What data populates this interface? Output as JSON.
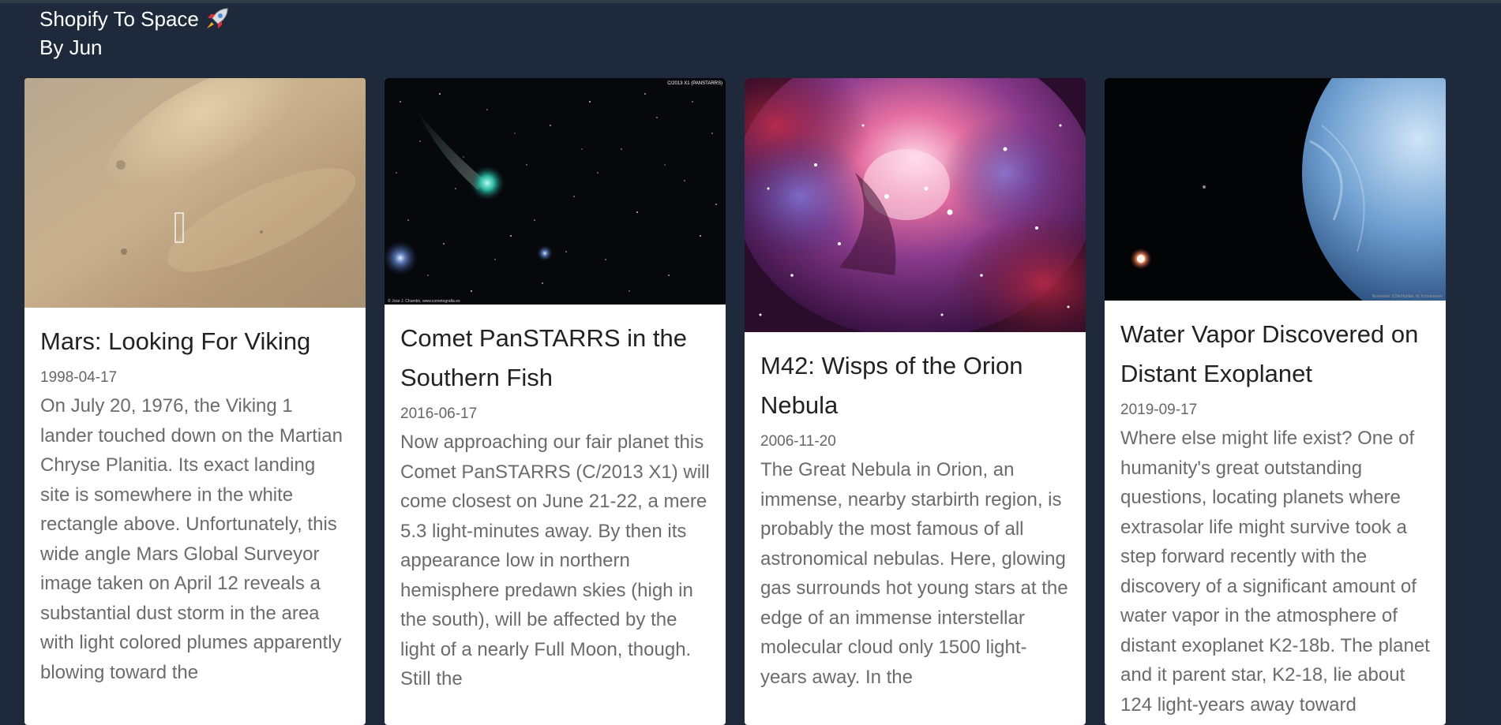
{
  "header": {
    "title": "Shopify To Space",
    "byline": "By Jun"
  },
  "cards": [
    {
      "title": "Mars: Looking For Viking",
      "date": "1998-04-17",
      "description": "On July 20, 1976, the Viking 1 lander touched down on the Martian Chryse Planitia. Its exact landing site is somewhere in the white rectangle above. Unfortunately, this wide angle Mars Global Surveyor image taken on April 12 reveals a substantial dust storm in the area with light colored plumes apparently blowing toward the"
    },
    {
      "title": "Comet PanSTARRS in the Southern Fish",
      "date": "2016-06-17",
      "description": "Now approaching our fair planet this Comet PanSTARRS (C/2013 X1) will come closest on June 21-22, a mere 5.3 light-minutes away. By then its appearance low in northern hemisphere predawn skies (high in the south), will be affected by the light of a nearly Full Moon, though. Still the",
      "image_caption_top": "C/2013 X1 (PANSTARRS)",
      "image_caption_bottom": "© Jose J. Chambó, www.cometografia.es"
    },
    {
      "title": "M42: Wisps of the Orion Nebula",
      "date": "2006-11-20",
      "description": "The Great Nebula in Orion, an immense, nearby starbirth region, is probably the most famous of all astronomical nebulas. Here, glowing gas surrounds hot young stars at the edge of an immense interstellar molecular cloud only 1500 light-years away. In the"
    },
    {
      "title": "Water Vapor Discovered on Distant Exoplanet",
      "date": "2019-09-17",
      "description": "Where else might life exist? One of humanity's great outstanding questions, locating planets where extrasolar life might survive took a step forward recently with the discovery of a significant amount of water vapor in the atmosphere of distant exoplanet K2-18b. The planet and it parent star, K2-18, lie about 124 light-years away toward",
      "image_caption_bottom": "Illustration: ESA/Hubble, M. Kornmesser"
    }
  ]
}
